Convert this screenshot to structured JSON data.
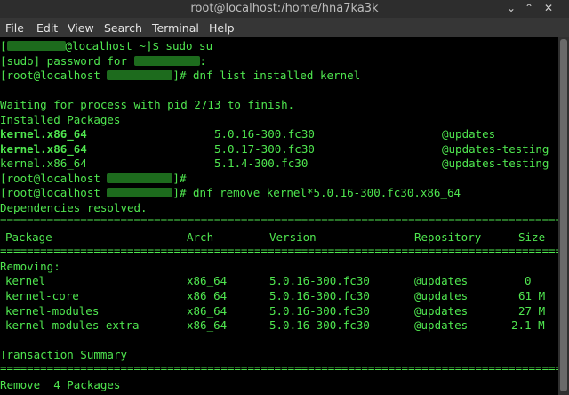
{
  "window": {
    "title": "root@localhost:/home/hna7ka3k",
    "minimize_glyph": "⌄",
    "maximize_glyph": "⌃",
    "close_glyph": "✕"
  },
  "menu": [
    "File",
    "Edit",
    "View",
    "Search",
    "Terminal",
    "Help"
  ],
  "colors": {
    "text": "#4fe64f",
    "background": "#000000",
    "redaction": "#1d6b1d"
  },
  "terminal": {
    "l01a": "[",
    "l01b": "@localhost ~]$ sudo su",
    "l02a": "[sudo] password for ",
    "l02b": ":",
    "l03a": "[root@localhost ",
    "l03b": "]# dnf list installed kernel",
    "l05": "Waiting for process with pid 2713 to finish.",
    "l06": "Installed Packages",
    "l07": [
      "kernel.x86_64",
      "5.0.16-300.fc30",
      "@updates"
    ],
    "l08": [
      "kernel.x86_64",
      "5.0.17-300.fc30",
      "@updates-testing"
    ],
    "l09": [
      "kernel.x86_64",
      "5.1.4-300.fc30",
      "@updates-testing"
    ],
    "l10a": "[root@localhost ",
    "l10b": "]#",
    "l11a": "[root@localhost ",
    "l11b": "]# dnf remove kernel*5.0.16-300.fc30.x86_64",
    "l12": "Dependencies resolved.",
    "separator": "==============================================================================================================",
    "table_header": [
      "Package",
      "Arch",
      "Version",
      "Repository",
      "Size"
    ],
    "removing_label": "Removing:",
    "rows": [
      [
        "kernel",
        "x86_64",
        "5.0.16-300.fc30",
        "@updates",
        "0"
      ],
      [
        "kernel-core",
        "x86_64",
        "5.0.16-300.fc30",
        "@updates",
        "61 M"
      ],
      [
        "kernel-modules",
        "x86_64",
        "5.0.16-300.fc30",
        "@updates",
        "27 M"
      ],
      [
        "kernel-modules-extra",
        "x86_64",
        "5.0.16-300.fc30",
        "@updates",
        "2.1 M"
      ]
    ],
    "transaction_summary": "Transaction Summary",
    "remove_summary": "Remove  4 Packages"
  }
}
